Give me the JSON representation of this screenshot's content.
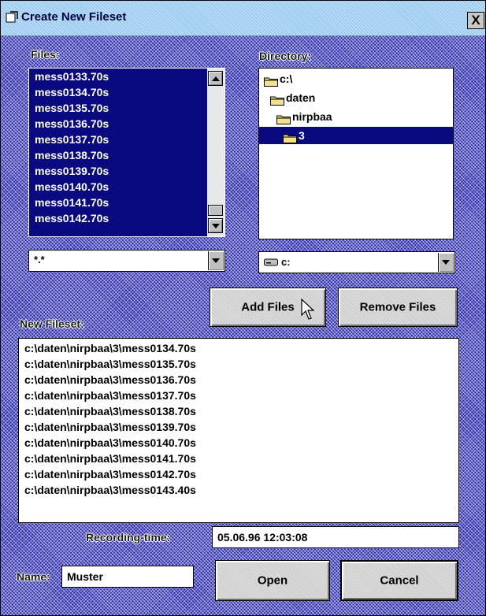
{
  "window": {
    "title": "Create New Fileset",
    "close_label": "X"
  },
  "files": {
    "label": "Files:",
    "items": [
      "mess0133.70s",
      "mess0134.70s",
      "mess0135.70s",
      "mess0136.70s",
      "mess0137.70s",
      "mess0138.70s",
      "mess0139.70s",
      "mess0140.70s",
      "mess0141.70s",
      "mess0142.70s"
    ],
    "filter": "*.*"
  },
  "directory": {
    "label": "Directory:",
    "items": [
      {
        "name": "c:\\",
        "selected": false
      },
      {
        "name": "daten",
        "selected": false
      },
      {
        "name": "nirpbaa",
        "selected": false
      },
      {
        "name": "3",
        "selected": true
      }
    ],
    "drive": "c:"
  },
  "buttons": {
    "add": "Add Files",
    "remove": "Remove Files",
    "open": "Open",
    "cancel": "Cancel"
  },
  "fileset": {
    "label": "New Fileset:",
    "items": [
      "c:\\daten\\nirpbaa\\3\\mess0134.70s",
      "c:\\daten\\nirpbaa\\3\\mess0135.70s",
      "c:\\daten\\nirpbaa\\3\\mess0136.70s",
      "c:\\daten\\nirpbaa\\3\\mess0137.70s",
      "c:\\daten\\nirpbaa\\3\\mess0138.70s",
      "c:\\daten\\nirpbaa\\3\\mess0139.70s",
      "c:\\daten\\nirpbaa\\3\\mess0140.70s",
      "c:\\daten\\nirpbaa\\3\\mess0141.70s",
      "c:\\daten\\nirpbaa\\3\\mess0142.70s",
      "c:\\daten\\nirpbaa\\3\\mess0143.40s"
    ]
  },
  "recording": {
    "label": "Recording-time:",
    "value": "05.06.96 12:03:08"
  },
  "name": {
    "label": "Name:",
    "value": "Muster"
  },
  "colors": {
    "selection": "#0a0a80",
    "dialog_pattern": "#2c2cae",
    "titlebar": "#9ccbf0"
  },
  "icons": {
    "title": "dialog-icon",
    "folder": "folder-icon",
    "drive": "drive-icon",
    "cursor": "mouse-pointer-icon"
  }
}
